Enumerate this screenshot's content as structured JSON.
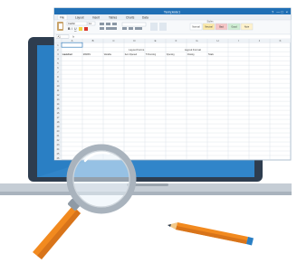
{
  "window": {
    "title": "Template1",
    "controls": [
      "?",
      "—",
      "□",
      "×"
    ]
  },
  "ribbon": {
    "tabs": [
      "File",
      "Layout",
      "Insert",
      "Tables",
      "Charts",
      "Data"
    ],
    "active_tab": "File",
    "font_name": "Calibri",
    "font_size": "11",
    "styles_group_label": "Styles",
    "styles": [
      {
        "label": "Normal",
        "color": "#ffffff"
      },
      {
        "label": "Neutral",
        "color": "#fdeaa8"
      },
      {
        "label": "Bad",
        "color": "#f6c5c5"
      },
      {
        "label": "Good",
        "color": "#cfeed3"
      },
      {
        "label": "Note",
        "color": "#fff2cc"
      }
    ]
  },
  "formula_bar": {
    "cell_ref": "A1",
    "fx_label": "fx"
  },
  "sheet": {
    "columns": [
      "A",
      "B",
      "C",
      "D",
      "E",
      "F",
      "G",
      "H",
      "I",
      "J",
      "K"
    ],
    "row_count": 26,
    "headers": {
      "group1": "Layout Forms",
      "group2": "Layout Format"
    },
    "row3": [
      "Launched",
      "MARKS",
      "Variable",
      "Item Opened",
      "Tr Running",
      "Opening",
      "Closing",
      "Totals"
    ]
  },
  "colors": {
    "monitor_bezel": "#2e3d4f",
    "screen_blue": "#2a7fc4",
    "window_header": "#1f6fb5",
    "sheet_bg": "#ffffff",
    "grid": "#d4dbe3",
    "laptop_base": "#c5cdd5",
    "magnifier_handle": "#f28a1f",
    "magnifier_rim": "#a9b3bd",
    "pencil_body": "#f28a1f",
    "pencil_tip": "#f2c98a"
  },
  "icons": {
    "magnifier": "magnifying-glass-icon",
    "pencil": "pencil-icon"
  }
}
